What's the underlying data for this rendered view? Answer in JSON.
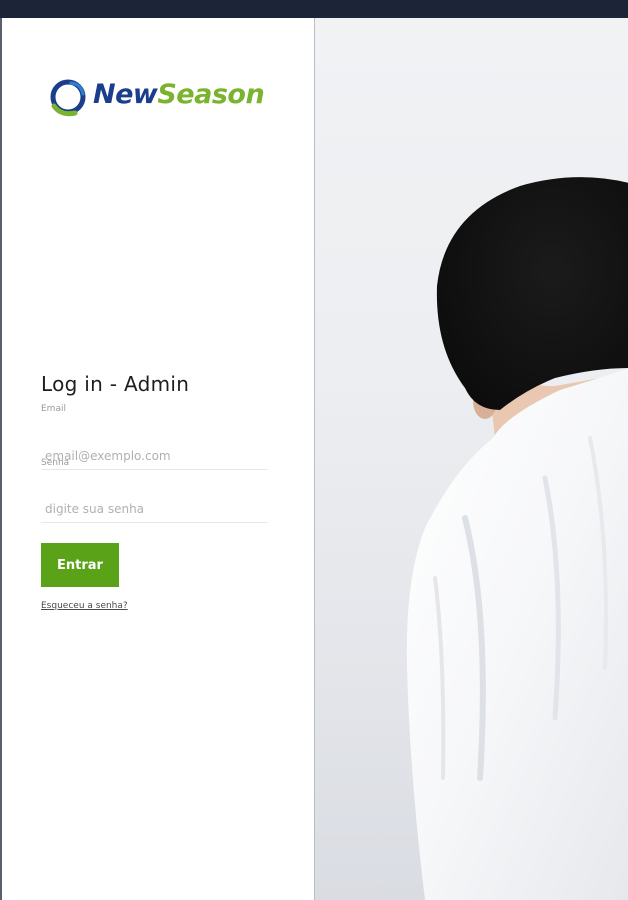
{
  "brand": {
    "name_part1": "New",
    "name_part2": "Season"
  },
  "login": {
    "title": "Log in - Admin",
    "email_label": "Email",
    "email_placeholder": "email@exemplo.com",
    "password_label": "Senha",
    "password_placeholder": "digite sua senha",
    "submit_label": "Entrar",
    "forgot_link": "Esqueceu a senha?"
  },
  "colors": {
    "brand_blue": "#1b3e8c",
    "brand_green": "#7ab32e",
    "button_green": "#5aa319",
    "top_bar": "#1c2438"
  },
  "hero_image": {
    "subject": "person-in-white-shirt-from-behind"
  }
}
